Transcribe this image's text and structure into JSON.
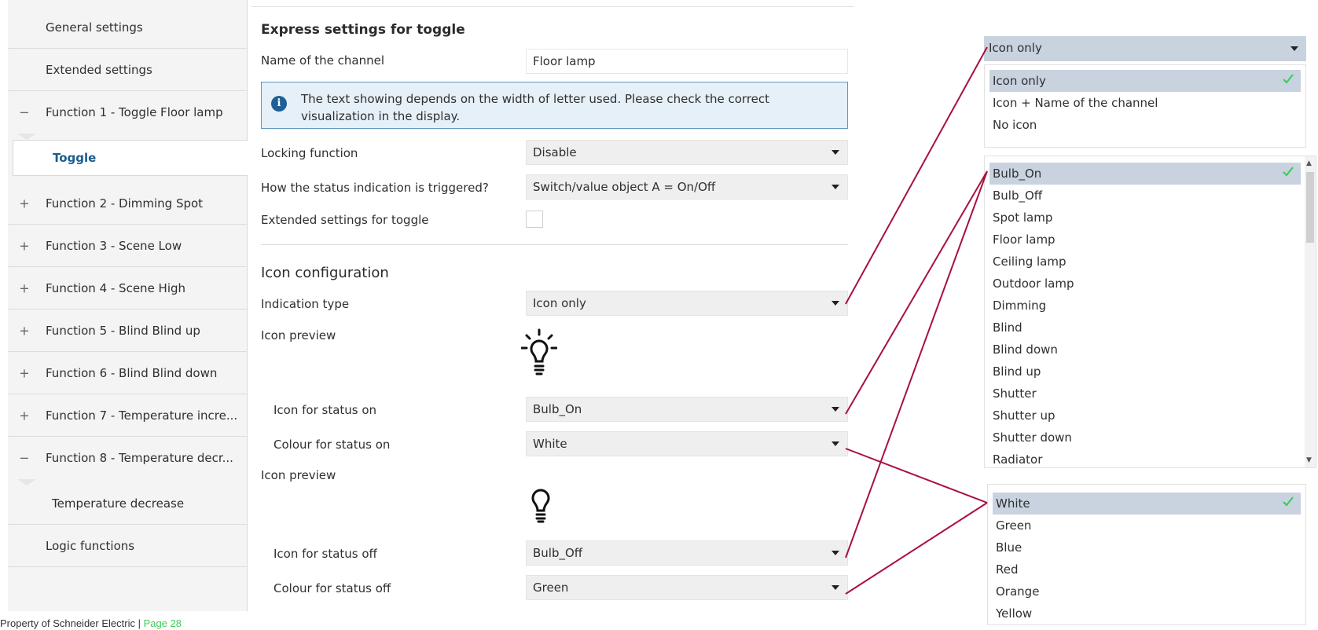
{
  "sidebar": {
    "items": [
      {
        "label": "General settings",
        "sign": ""
      },
      {
        "label": "Extended settings",
        "sign": ""
      },
      {
        "label": "Function 1 - Toggle Floor lamp",
        "sign": "−"
      },
      {
        "label": "Toggle",
        "sign": ""
      },
      {
        "label": "Function 2 - Dimming Spot",
        "sign": "+"
      },
      {
        "label": "Function 3 - Scene Low",
        "sign": "+"
      },
      {
        "label": "Function 4 - Scene High",
        "sign": "+"
      },
      {
        "label": "Function 5 - Blind Blind up",
        "sign": "+"
      },
      {
        "label": "Function 6 - Blind Blind down",
        "sign": "+"
      },
      {
        "label": "Function 7 - Temperature incre...",
        "sign": "+"
      },
      {
        "label": "Function 8 - Temperature decr...",
        "sign": "−"
      },
      {
        "label": "Temperature decrease",
        "sign": ""
      },
      {
        "label": "Logic functions",
        "sign": ""
      }
    ]
  },
  "main": {
    "express_title": "Express settings for toggle",
    "channel_name_label": "Name of the channel",
    "channel_name_value": "Floor lamp",
    "info_text": "The text showing depends on the width of letter used. Please check the correct visualization in the display.",
    "locking_label": "Locking function",
    "locking_value": "Disable",
    "status_trigger_label": "How the status indication is triggered?",
    "status_trigger_value": "Switch/value object A = On/Off",
    "extended_toggle_label": "Extended settings for toggle",
    "icon_config_title": "Icon configuration",
    "indication_type_label": "Indication type",
    "indication_type_value": "Icon only",
    "icon_preview_label": "Icon preview",
    "icon_on_label": "Icon for status on",
    "icon_on_value": "Bulb_On",
    "colour_on_label": "Colour for status on",
    "colour_on_value": "White",
    "icon_preview_label_2": "Icon preview",
    "icon_off_label": "Icon for status off",
    "icon_off_value": "Bulb_Off",
    "colour_off_label": "Colour for status off",
    "colour_off_value": "Green"
  },
  "dropdowns": {
    "indication_header": "Icon only",
    "indication_options": [
      "Icon only",
      "Icon + Name of the channel",
      "No icon"
    ],
    "icon_options": [
      "Bulb_On",
      "Bulb_Off",
      "Spot lamp",
      "Floor lamp",
      "Ceiling lamp",
      "Outdoor lamp",
      "Dimming",
      "Blind",
      "Blind down",
      "Blind up",
      "Shutter",
      "Shutter up",
      "Shutter down",
      "Radiator"
    ],
    "colour_options": [
      "White",
      "Green",
      "Blue",
      "Red",
      "Orange",
      "Yellow"
    ]
  },
  "footer": {
    "text": "Property of Schneider Electric | ",
    "page": "Page 28"
  },
  "colors": {
    "connector": "#a8103e",
    "selected_bg": "#c9d3e0",
    "check": "#3dcd58",
    "active_nav_text": "#1b5e8e"
  }
}
